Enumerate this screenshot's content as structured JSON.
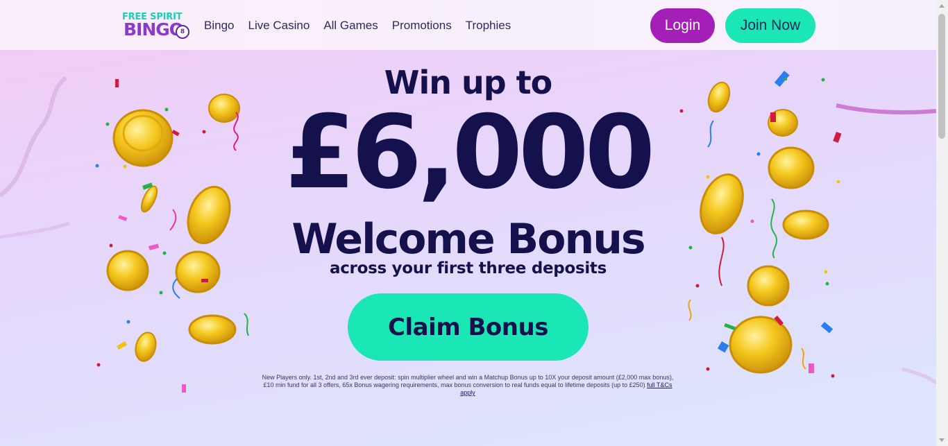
{
  "header": {
    "logo": {
      "line1": "FREE SPIRIT",
      "line2": "BINGO",
      "ball_number": "8"
    },
    "nav": [
      {
        "label": "Bingo"
      },
      {
        "label": "Live Casino"
      },
      {
        "label": "All Games"
      },
      {
        "label": "Promotions"
      },
      {
        "label": "Trophies"
      }
    ],
    "login_label": "Login",
    "join_label": "Join Now"
  },
  "hero": {
    "line1": "Win up to",
    "amount": "£6,000",
    "line3": "Welcome Bonus",
    "subline": "across your first three deposits",
    "cta_label": "Claim Bonus",
    "terms_text": "New Players only. 1st, 2nd and 3rd ever deposit: spin multiplier wheel and win a Matchup Bonus up to 10X your deposit amount (£2,000 max bonus), £10 min fund for all 3 offers, 65x Bonus wagering requirements, max bonus conversion to real funds equal to lifetime deposits (up to £250)",
    "terms_link": "full T&Cs apply"
  },
  "colors": {
    "brand_purple": "#a31fb8",
    "brand_teal": "#1be6b5",
    "headline_navy": "#15114d",
    "coin_gold": "#f2c21d"
  }
}
